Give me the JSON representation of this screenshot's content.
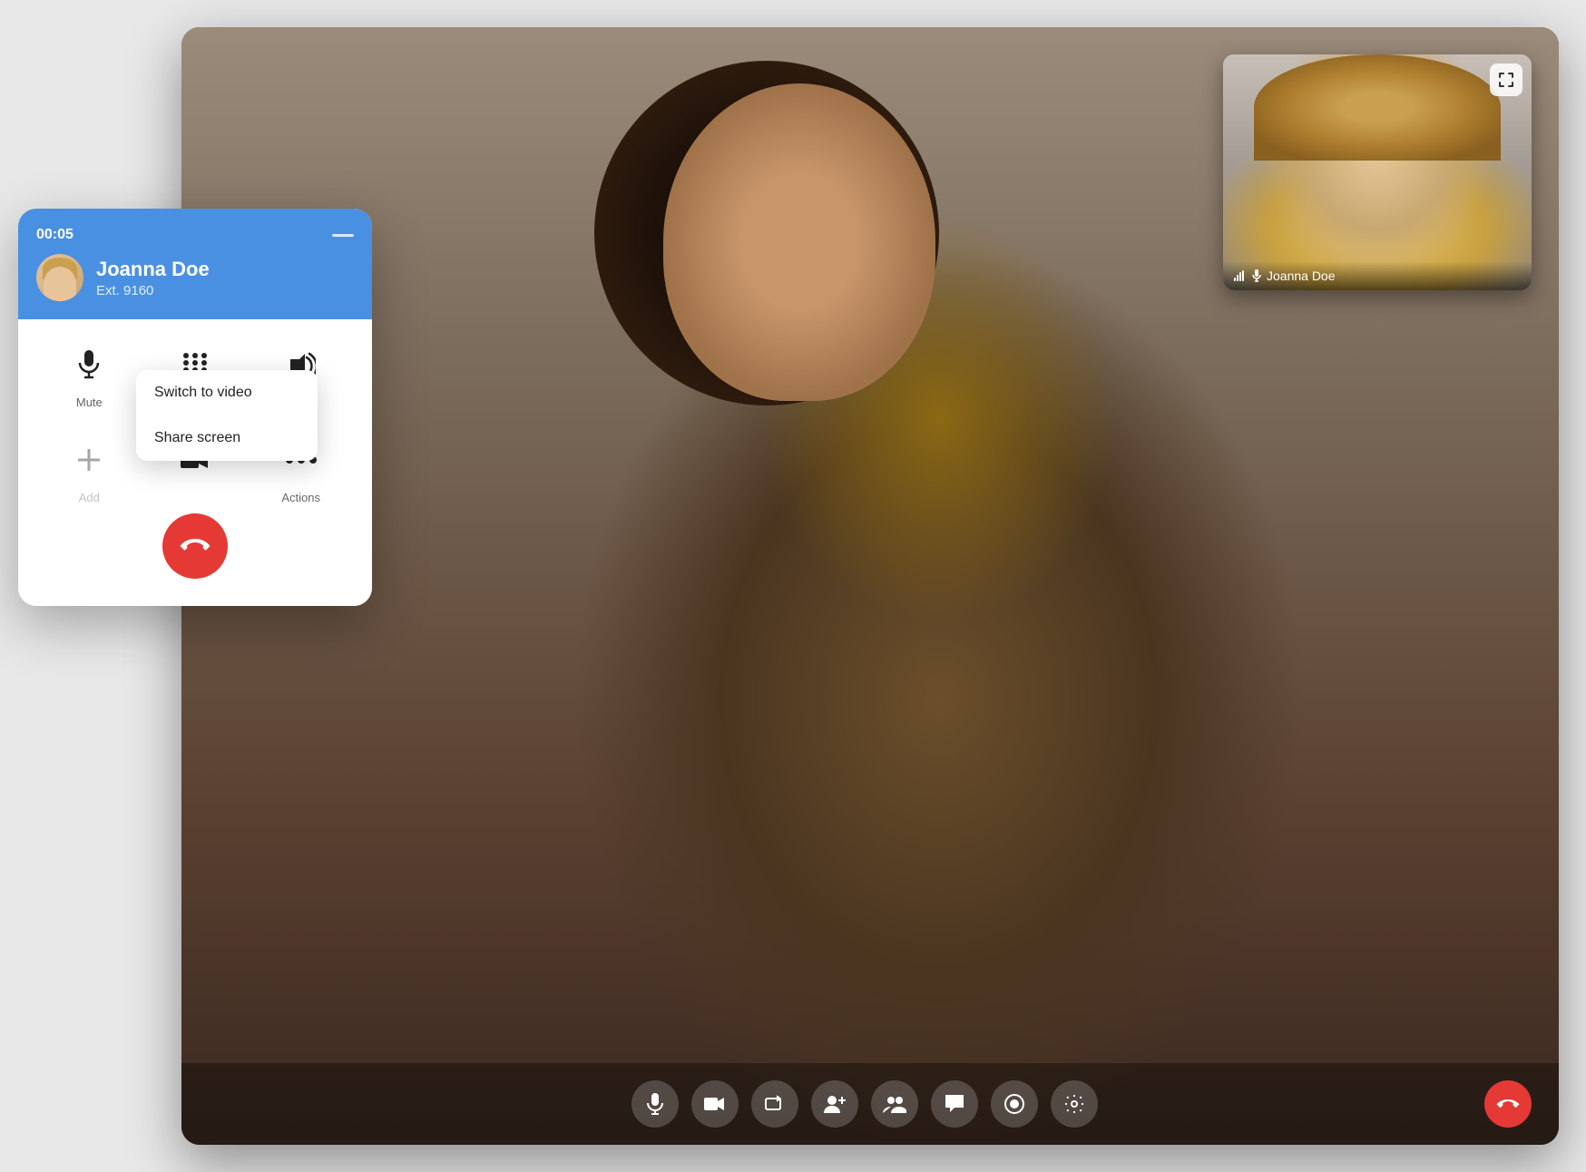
{
  "scene": {
    "background_color": "#e0e0e0"
  },
  "video_window": {
    "pip": {
      "name": "Joanna Doe",
      "expand_label": "⤢",
      "signal_icon": "📶",
      "mic_icon": "🎤"
    }
  },
  "call_widget": {
    "timer": "00:05",
    "minimize_label": "—",
    "caller_name": "Joanna Doe",
    "caller_ext": "Ext. 9160",
    "actions_row1": [
      {
        "id": "mute",
        "label": "Mute"
      },
      {
        "id": "keypad",
        "label": "Keypad"
      },
      {
        "id": "audio",
        "label": "Audio"
      }
    ],
    "actions_row2": [
      {
        "id": "add",
        "label": "Add"
      },
      {
        "id": "video",
        "label": ""
      },
      {
        "id": "more",
        "label": "Actions"
      }
    ],
    "end_call_label": "📞"
  },
  "dropdown": {
    "items": [
      {
        "id": "switch-video",
        "label": "Switch to video"
      },
      {
        "id": "share-screen",
        "label": "Share screen"
      }
    ]
  },
  "video_controls": {
    "buttons": [
      {
        "id": "mic",
        "icon": "mic"
      },
      {
        "id": "camera",
        "icon": "camera"
      },
      {
        "id": "share",
        "icon": "share"
      },
      {
        "id": "add-person",
        "icon": "add-person"
      },
      {
        "id": "people",
        "icon": "people"
      },
      {
        "id": "chat",
        "icon": "chat"
      },
      {
        "id": "record",
        "icon": "record"
      },
      {
        "id": "settings",
        "icon": "settings"
      }
    ],
    "end_call": {
      "id": "end-call",
      "icon": "phone-end"
    }
  }
}
